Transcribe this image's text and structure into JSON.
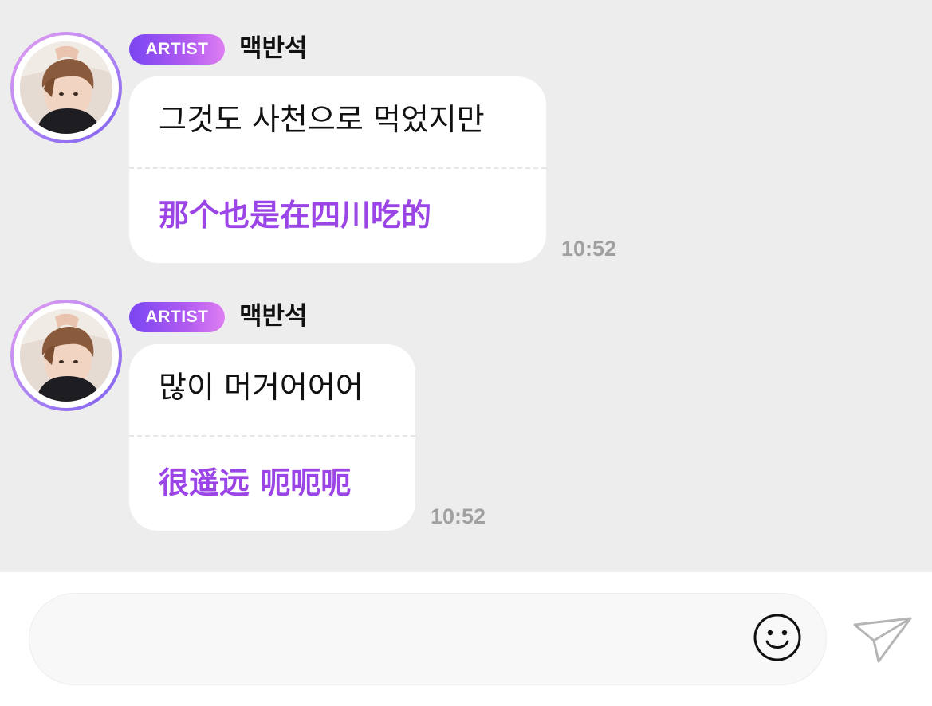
{
  "messages": [
    {
      "badge": "ARTIST",
      "sender": "맥반석",
      "original": "그것도 사천으로 먹었지만",
      "translation": "那个也是在四川吃的",
      "time": "10:52"
    },
    {
      "badge": "ARTIST",
      "sender": "맥반석",
      "original": "많이 머거어어어",
      "translation": "很遥远 呃呃呃",
      "time": "10:52"
    }
  ],
  "input": {
    "placeholder": "",
    "emoji_icon": "smiley-face-icon",
    "send_icon": "paper-plane-send-icon"
  },
  "colors": {
    "chat_background": "#ededee",
    "bubble": "#ffffff",
    "translation_text": "#9b45e6",
    "badge_gradient_start": "#7a45f2",
    "badge_gradient_end": "#e07ff3",
    "timestamp": "#a0a0a0"
  }
}
